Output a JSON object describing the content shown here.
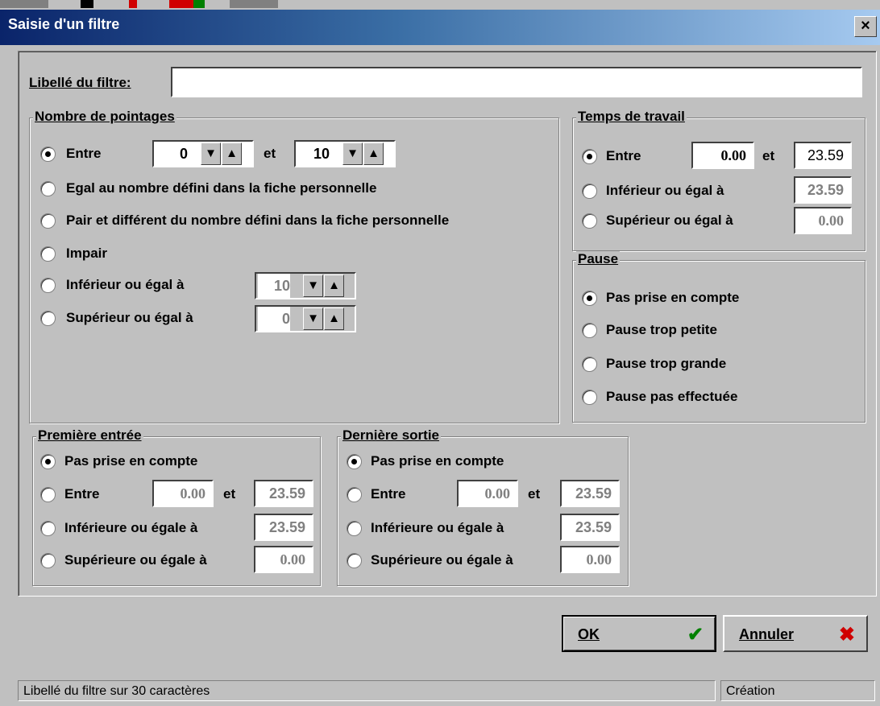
{
  "window": {
    "title": "Saisie d'un filtre",
    "close": "×"
  },
  "libelle": {
    "label": "Libellé du filtre:",
    "value": ""
  },
  "nombre": {
    "legend": "Nombre de pointages",
    "entre": {
      "label": "Entre",
      "min": "0",
      "et": "et",
      "max": "10"
    },
    "egal": "Egal au nombre défini dans la fiche personnelle",
    "pair": "Pair et différent du nombre défini dans la fiche personnelle",
    "impair": "Impair",
    "inferieur": {
      "label": "Inférieur ou égal à",
      "value": "10"
    },
    "superieur": {
      "label": "Supérieur ou égal à",
      "value": "0"
    }
  },
  "temps": {
    "legend": "Temps de travail",
    "entre": {
      "label": "Entre",
      "min": "0.00",
      "et": "et",
      "max": "23.59"
    },
    "inferieur": {
      "label": "Inférieur ou égal à",
      "value": "23.59"
    },
    "superieur": {
      "label": "Supérieur ou égal à",
      "value": "0.00"
    }
  },
  "pause": {
    "legend": "Pause",
    "options": [
      "Pas prise en compte",
      "Pause trop petite",
      "Pause trop grande",
      "Pause pas effectuée"
    ]
  },
  "premiere": {
    "legend": "Première entrée",
    "pas": "Pas prise en compte",
    "entre": {
      "label": "Entre",
      "min": "0.00",
      "et": "et",
      "max": "23.59"
    },
    "inferieure": {
      "label": "Inférieure ou égale à",
      "value": "23.59"
    },
    "superieure": {
      "label": "Supérieure ou égale à",
      "value": "0.00"
    }
  },
  "derniere": {
    "legend": "Dernière sortie",
    "pas": "Pas prise en compte",
    "entre": {
      "label": "Entre",
      "min": "0.00",
      "et": "et",
      "max": "23.59"
    },
    "inferieure": {
      "label": "Inférieure ou égale à",
      "value": "23.59"
    },
    "superieure": {
      "label": "Supérieure ou égale à",
      "value": "0.00"
    }
  },
  "buttons": {
    "ok": "OK",
    "ok_icon": "✔",
    "cancel": "Annuler",
    "cancel_icon": "✖"
  },
  "status": {
    "left": "Libellé du filtre sur 30 caractères",
    "right": "Création"
  },
  "icons": {
    "spin_down": "▼",
    "spin_up": "▲"
  }
}
